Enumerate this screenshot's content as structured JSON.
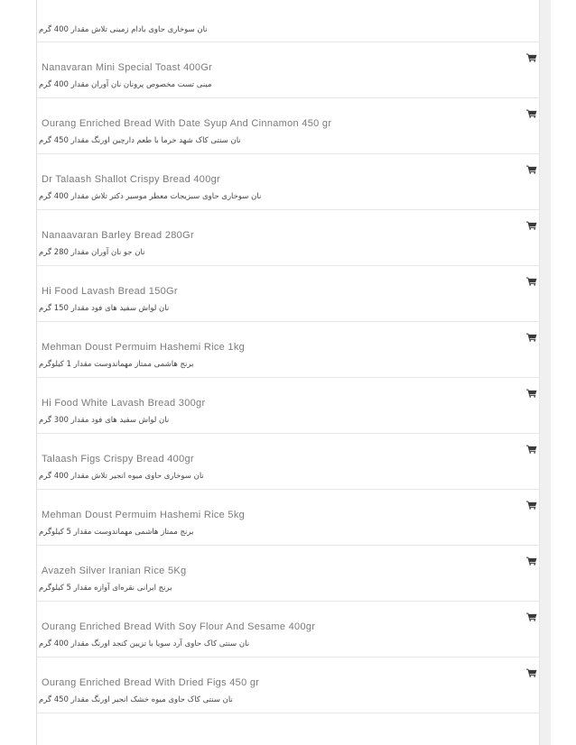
{
  "items": [
    {
      "en": "",
      "fa": "نان سوخاری حاوی بادام زمینی تلاش مقدار 400 گرم"
    },
    {
      "en": "Nanavaran Mini Special Toast 400Gr",
      "fa": "مینی تست مخصوص پرونان نان آوران مقدار 400 گرم"
    },
    {
      "en": "Ourang Enriched Bread With Date Syup And Cinnamon 450 gr",
      "fa": "نان سنتی کاک شهد خرما با طعم دارچین اورنگ مقدار 450 گرم"
    },
    {
      "en": "Dr Talaash Shallot Crispy Bread 400gr",
      "fa": "نان سوخاری حاوی سبزیجات معطر موسیر دکتر تلاش مقدار 400 گرم"
    },
    {
      "en": "Nanaavaran Barley Bread 280Gr",
      "fa": "نان جو نان آوران مقدار 280 گرم"
    },
    {
      "en": "Hi Food Lavash Bread 150Gr",
      "fa": "نان لواش سفید های فود مقدار 150 گرم"
    },
    {
      "en": "Mehman Doust Permuim Hashemi Rice 1kg",
      "fa": "برنج هاشمی ممتاز مهماندوست مقدار 1 کیلوگرم"
    },
    {
      "en": "Hi Food White Lavash Bread 300gr",
      "fa": "نان لواش سفید های فود مقدار 300 گرم"
    },
    {
      "en": "Talaash Figs Crispy Bread 400gr",
      "fa": "نان سوخاری حاوی میوه انجیر تلاش مقدار 400 گرم"
    },
    {
      "en": "Mehman Doust Permuim Hashemi Rice 5kg",
      "fa": "برنج ممتاز هاشمی مهماندوست مقدار 5 کیلوگرم"
    },
    {
      "en": "Avazeh Silver Iranian Rice 5Kg",
      "fa": "برنج ایرانی نقره‌ای آوازه مقدار 5 کیلوگرم"
    },
    {
      "en": "Ourang Enriched Bread With Soy Flour And Sesame 400gr",
      "fa": "نان سنتی کاک حاوی آرد سویا با تزیین کنجد اورنگ مقدار 400 گرم"
    },
    {
      "en": "Ourang Enriched Bread With Dried Figs 450 gr",
      "fa": "نان سنتی کاک حاوی میوه خشک انجیر اورنگ مقدار 450 گرم"
    }
  ],
  "icons": {
    "cart": "shopping-cart-icon"
  }
}
